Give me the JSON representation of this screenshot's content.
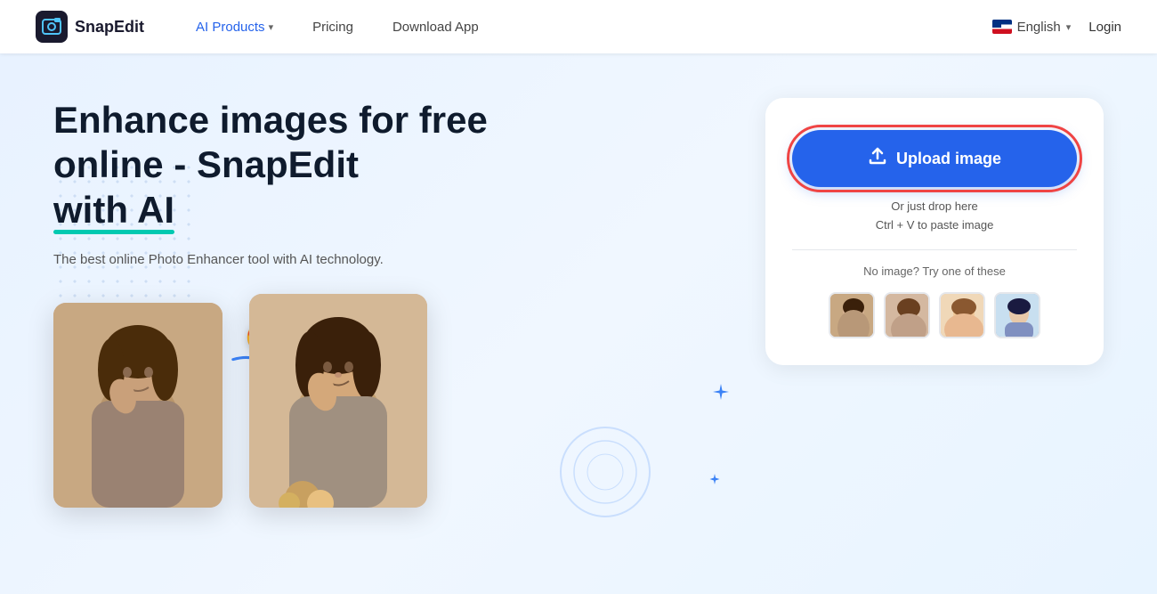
{
  "nav": {
    "logo_text": "SnapEdit",
    "products_label": "AI Products",
    "pricing_label": "Pricing",
    "download_label": "Download App",
    "lang_label": "English",
    "login_label": "Login"
  },
  "hero": {
    "title_line1": "Enhance images for free",
    "title_line2": "online - SnapEdit",
    "title_line3": "with AI",
    "subtitle": "The best online Photo Enhancer tool with AI technology.",
    "upload_button": "Upload image",
    "drop_hint_line1": "Or just drop here",
    "drop_hint_line2": "Ctrl + V to paste image",
    "sample_label": "No image? Try one of these"
  }
}
